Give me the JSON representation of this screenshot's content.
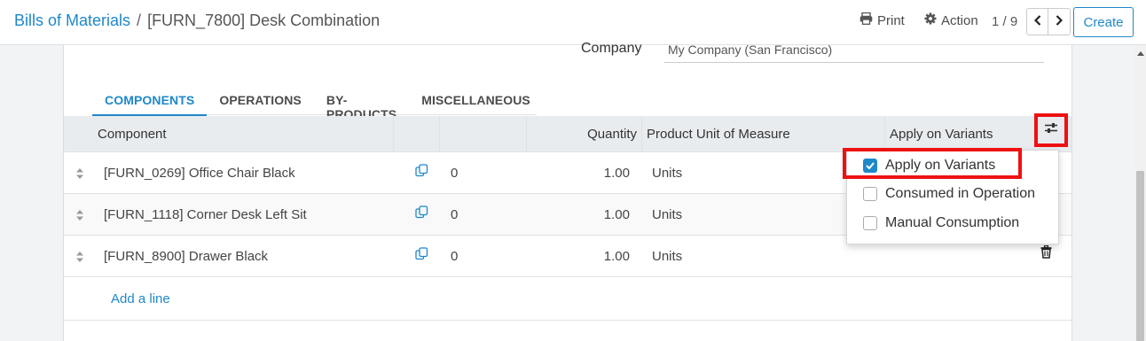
{
  "breadcrumb": {
    "parent": "Bills of Materials",
    "separator": "/",
    "current": "[FURN_7800] Desk Combination"
  },
  "toolbar": {
    "print_label": "Print",
    "action_label": "Action",
    "pager": "1 / 9",
    "create_label": "Create"
  },
  "form": {
    "company_label": "Company",
    "company_value": "My Company (San Francisco)"
  },
  "tabs": [
    {
      "label": "COMPONENTS",
      "active": true
    },
    {
      "label": "OPERATIONS"
    },
    {
      "label": "BY-PRODUCTS"
    },
    {
      "label": "MISCELLANEOUS"
    }
  ],
  "table": {
    "headers": {
      "component": "Component",
      "quantity": "Quantity",
      "uom": "Product Unit of Measure",
      "variants": "Apply on Variants"
    },
    "rows": [
      {
        "component": "[FURN_0269] Office Chair Black",
        "operations": "0",
        "quantity": "1.00",
        "uom": "Units"
      },
      {
        "component": "[FURN_1118] Corner Desk Left Sit",
        "operations": "0",
        "quantity": "1.00",
        "uom": "Units"
      },
      {
        "component": "[FURN_8900] Drawer Black",
        "operations": "0",
        "quantity": "1.00",
        "uom": "Units"
      }
    ],
    "add_line_label": "Add a line"
  },
  "optional_columns": [
    {
      "label": "Apply on Variants",
      "checked": true
    },
    {
      "label": "Consumed in Operation",
      "checked": false
    },
    {
      "label": "Manual Consumption",
      "checked": false
    }
  ],
  "colors": {
    "accent": "#1f88c9",
    "highlight_box": "#ee1111"
  },
  "icons": [
    "print-icon",
    "gear-icon",
    "chevron-left-icon",
    "chevron-right-icon",
    "sliders-icon",
    "copy-icon",
    "drag-handle-icon",
    "trash-icon",
    "scroll-up-icon"
  ]
}
